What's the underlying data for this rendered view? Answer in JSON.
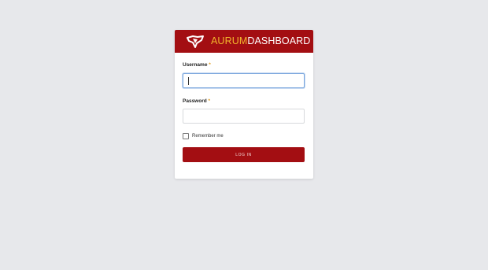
{
  "brand": {
    "name_part1": "AURUM",
    "name_part2": "DASHBOARD",
    "logo_icon": "map-shape-icon",
    "colors": {
      "bar": "#a30e12",
      "accent": "#f1b52c",
      "text": "#ffffff"
    }
  },
  "form": {
    "username": {
      "label": "Username",
      "required_mark": "*",
      "value": "",
      "focused": true
    },
    "password": {
      "label": "Password",
      "required_mark": "*",
      "value": ""
    },
    "remember_me": {
      "label": "Remember me",
      "checked": false
    },
    "login_button_label": "LOG IN"
  }
}
